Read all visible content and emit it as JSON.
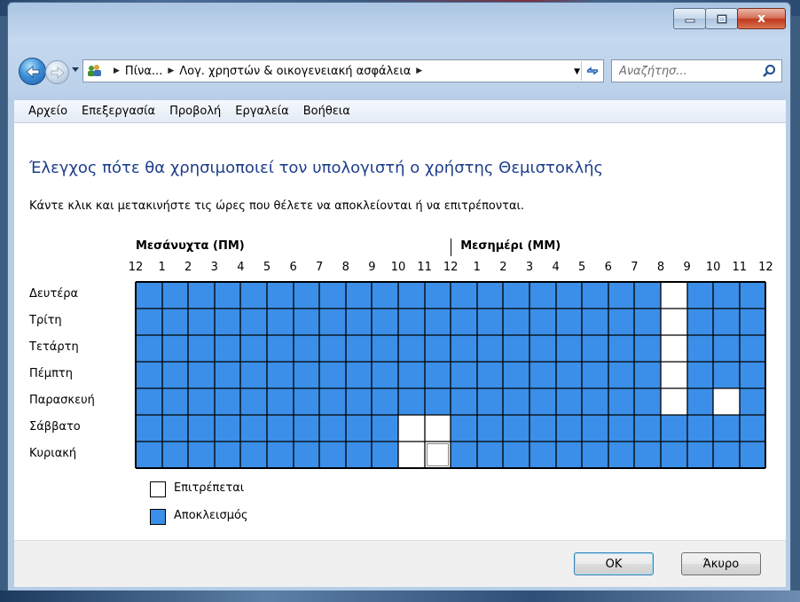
{
  "window": {
    "caption_buttons": [
      "minimize",
      "maximize",
      "close"
    ],
    "close_glyph": "x"
  },
  "navigation": {
    "breadcrumbs": [
      "Πίνα...",
      "Λογ. χρηστών & οικογενειακή ασφάλεια"
    ],
    "search_placeholder": "Αναζήτησ..."
  },
  "menu": [
    "Αρχείο",
    "Επεξεργασία",
    "Προβολή",
    "Εργαλεία",
    "Βοήθεια"
  ],
  "page": {
    "title": "Έλεγχος πότε θα χρησιμοποιεί τον υπολογιστή ο χρήστης Θεμιστοκλής",
    "instructions": "Κάντε κλικ και μετακινήστε τις ώρες που θέλετε να αποκλείονται ή να επιτρέπονται."
  },
  "grid": {
    "am_label": "Μεσάνυχτα (ΠΜ)",
    "pm_label": "Μεσημέρι (ΜΜ)",
    "hour_labels": [
      "12",
      "1",
      "2",
      "3",
      "4",
      "5",
      "6",
      "7",
      "8",
      "9",
      "10",
      "11",
      "12",
      "1",
      "2",
      "3",
      "4",
      "5",
      "6",
      "7",
      "8",
      "9",
      "10",
      "11",
      "12"
    ],
    "days": [
      {
        "name": "Δευτέρα",
        "allowed_hours": [
          20
        ]
      },
      {
        "name": "Τρίτη",
        "allowed_hours": [
          20
        ]
      },
      {
        "name": "Τετάρτη",
        "allowed_hours": [
          20
        ]
      },
      {
        "name": "Πέμπτη",
        "allowed_hours": [
          20
        ]
      },
      {
        "name": "Παρασκευή",
        "allowed_hours": [
          20,
          22
        ]
      },
      {
        "name": "Σάββατο",
        "allowed_hours": [
          10,
          11
        ]
      },
      {
        "name": "Κυριακή",
        "allowed_hours": [
          10,
          11
        ]
      }
    ],
    "colors": {
      "blocked": "#3b8fe8",
      "allowed": "#ffffff",
      "grid_line": "#000000"
    }
  },
  "legend": {
    "allowed": "Επιτρέπεται",
    "blocked": "Αποκλεισμός"
  },
  "buttons": {
    "ok": "ΟΚ",
    "cancel": "Άκυρο"
  }
}
